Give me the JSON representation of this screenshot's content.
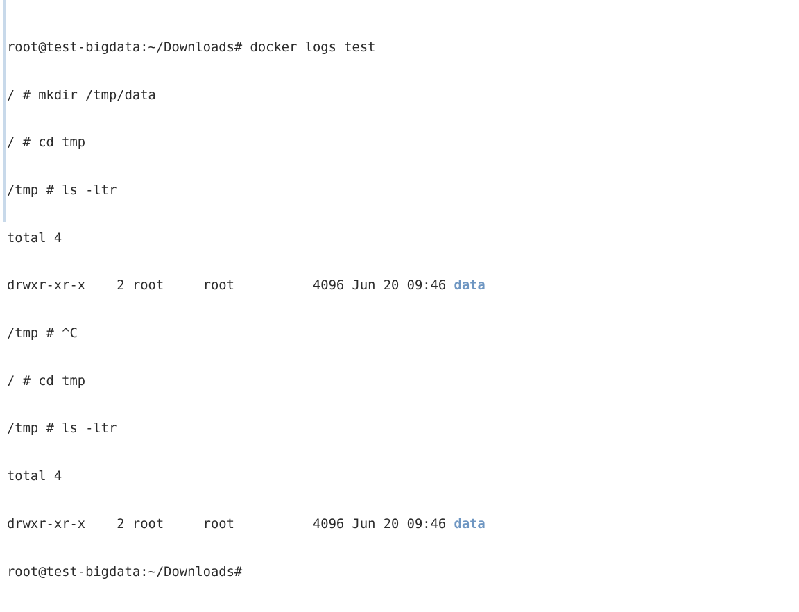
{
  "terminal": {
    "lines": [
      "root@test-bigdata:~/Downloads# docker logs test",
      "/ # mkdir /tmp/data",
      "/ # cd tmp",
      "/tmp # ls -ltr",
      "total 4",
      "drwxr-xr-x    2 root     root          4096 Jun 20 09:46 ",
      "/tmp # ^C",
      "/ # cd tmp",
      "/tmp # ls -ltr",
      "total 4",
      "drwxr-xr-x    2 root     root          4096 Jun 20 09:46 ",
      "root@test-bigdata:~/Downloads#"
    ],
    "dir_name_1": "data",
    "dir_name_2": "data",
    "colors": {
      "text": "#2b2b2b",
      "directory": "#6e96c2",
      "background": "#ffffff",
      "scroll_marker": "#c8d9ea"
    }
  }
}
